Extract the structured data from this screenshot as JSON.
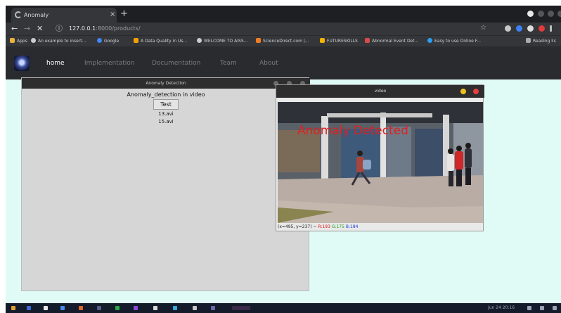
{
  "browser": {
    "tab_title": "Anomaly",
    "tab_close": "×",
    "new_tab": "+",
    "url_host": "127.0.0.1",
    "url_rest": ":8000/products/",
    "bookmarks": [
      {
        "label": "Apps",
        "color": "#e8b33a"
      },
      {
        "label": "An example to insert...",
        "color": "#cccccc"
      },
      {
        "label": "Google",
        "color": "#4285f4"
      },
      {
        "label": "A Data Quality in Us...",
        "color": "#f4a000"
      },
      {
        "label": "WELCOME TO AISS...",
        "color": "#cccccc"
      },
      {
        "label": "ScienceDirect.com |...",
        "color": "#f47c20"
      },
      {
        "label": "FUTURESKILLS",
        "color": "#f0b400"
      },
      {
        "label": "Abnormal Event Det...",
        "color": "#d94b4b"
      },
      {
        "label": "Easy to use Online F...",
        "color": "#2b9ef3"
      }
    ],
    "reading_list": "Reading lis"
  },
  "navbar": {
    "links": [
      "home",
      "Implementation",
      "Documentation",
      "Team",
      "About"
    ]
  },
  "tk_window": {
    "title": "Anomaly Detection",
    "heading": "Anomaly_detection in video",
    "button": "Test",
    "files": [
      "13.avi",
      "15.avi"
    ]
  },
  "video_window": {
    "title": "video",
    "overlay_text": "Anomaly Detected",
    "status_prefix": "(x=495, y=237) ~",
    "status_r": "R:193",
    "status_g": "G:175",
    "status_b": "B:184"
  },
  "taskbar": {
    "clock": "Jun 24 20:16"
  },
  "colors": {
    "page_background": "#e0fbf6",
    "overlay_red": "#e02020",
    "close_red": "#e84040",
    "minimize_yellow": "#f0c020"
  }
}
